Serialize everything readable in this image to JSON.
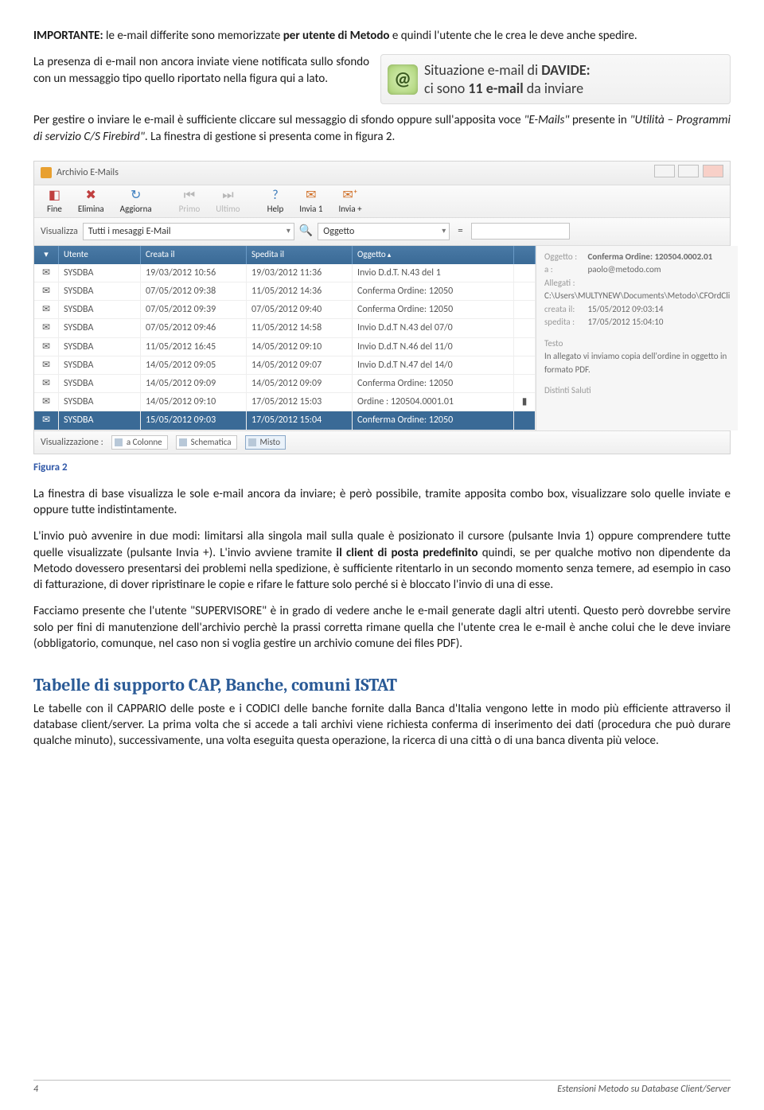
{
  "text": {
    "p1": "IMPORTANTE: le e-mail differite sono memorizzate per utente di Metodo e quindi l'utente che le crea le deve anche spedire.",
    "p2": "La presenza di e-mail non ancora inviate viene notificata sullo sfondo con un messaggio tipo quello riportato nella figura qui a lato.",
    "p3": "Per gestire o inviare le e-mail è sufficiente cliccare sul messaggio di sfondo oppure sull'apposita voce \"E-Mails\" presente in \"Utilità – Programmi di servizio C/S Firebird\". La finestra di gestione si presenta come in figura 2.",
    "caption": "Figura 2",
    "p4": "La finestra di base visualizza le sole e-mail ancora da inviare; è però possibile, tramite apposita combo box, visualizzare solo quelle inviate e oppure tutte indistintamente.",
    "p5": "L'invio può avvenire in due modi: limitarsi alla singola mail sulla quale è posizionato il cursore (pulsante Invia 1) oppure comprendere tutte quelle visualizzate (pulsante Invia +). L'invio avviene tramite il client di posta predefinito quindi, se per qualche motivo non dipendente da Metodo dovessero presentarsi dei problemi nella spedizione, è sufficiente ritentarlo in un secondo momento senza temere, ad esempio in caso di fatturazione, di dover ripristinare le copie e rifare le fatture solo perché si è bloccato l'invio di una di esse.",
    "p6": "Facciamo presente che l'utente \"SUPERVISORE\" è in grado di vedere anche le e-mail generate dagli altri utenti. Questo però dovrebbe servire solo per fini di manutenzione dell'archivio perchè la prassi corretta rimane quella che l'utente crea le e-mail è anche colui che le deve inviare (obbligatorio, comunque, nel caso non si voglia gestire un archivio comune dei files PDF).",
    "h2": "Tabelle di supporto CAP, Banche, comuni ISTAT",
    "p7": "Le tabelle con il CAPPARIO delle poste e i CODICI delle banche fornite dalla Banca d'Italia vengono lette in modo più efficiente attraverso il database client/server. La prima volta che si accede a tali archivi viene richiesta conferma di inserimento dei dati (procedura che può durare qualche minuto), successivamente, una volta eseguita questa operazione, la ricerca di una città o di una banca diventa più veloce."
  },
  "notify": {
    "line1_pre": "Situazione e-mail di ",
    "line1_bold": "DAVIDE:",
    "line2_pre": "ci sono ",
    "line2_bold": "11 e-mail",
    "line2_post": " da inviare"
  },
  "archive": {
    "title": "Archivio E-Mails",
    "toolbar": {
      "fine": "Fine",
      "elimina": "Elimina",
      "aggiorna": "Aggiorna",
      "primo": "Primo",
      "ultimo": "Ultimo",
      "help": "Help",
      "invia1": "Invia 1",
      "inviap": "Invia +"
    },
    "filter": {
      "visualizza_label": "Visualizza",
      "visualizza_value": "Tutti i mesaggi E-Mail",
      "oggetto_label": "Oggetto",
      "eq": "="
    },
    "columns": {
      "utente": "Utente",
      "creata": "Creata il",
      "spedita": "Spedita il",
      "oggetto": "Oggetto"
    },
    "rows": [
      {
        "utente": "SYSDBA",
        "creata": "19/03/2012 10:56",
        "spedita": "19/03/2012 11:36",
        "oggetto": "Invio D.d.T. N.43    del 1"
      },
      {
        "utente": "SYSDBA",
        "creata": "07/05/2012 09:38",
        "spedita": "11/05/2012 14:36",
        "oggetto": "Conferma Ordine: 12050"
      },
      {
        "utente": "SYSDBA",
        "creata": "07/05/2012 09:39",
        "spedita": "07/05/2012 09:40",
        "oggetto": "Conferma Ordine: 12050"
      },
      {
        "utente": "SYSDBA",
        "creata": "07/05/2012 09:46",
        "spedita": "11/05/2012 14:58",
        "oggetto": "Invio D.d.T N.43 del 07/0"
      },
      {
        "utente": "SYSDBA",
        "creata": "11/05/2012 16:45",
        "spedita": "14/05/2012 09:10",
        "oggetto": "Invio D.d.T N.46 del 11/0"
      },
      {
        "utente": "SYSDBA",
        "creata": "14/05/2012 09:05",
        "spedita": "14/05/2012 09:07",
        "oggetto": "Invio D.d.T N.47 del 14/0"
      },
      {
        "utente": "SYSDBA",
        "creata": "14/05/2012 09:09",
        "spedita": "14/05/2012 09:09",
        "oggetto": "Conferma Ordine: 12050"
      },
      {
        "utente": "SYSDBA",
        "creata": "14/05/2012 09:10",
        "spedita": "17/05/2012 15:03",
        "oggetto": "Ordine : 120504.0001.01"
      },
      {
        "utente": "SYSDBA",
        "creata": "15/05/2012 09:03",
        "spedita": "17/05/2012 15:04",
        "oggetto": "Conferma Ordine: 12050",
        "selected": true
      }
    ],
    "detail": {
      "oggetto_lab": "Oggetto :",
      "oggetto_val": "Conferma Ordine: 120504.0002.01",
      "a_lab": "a :",
      "a_val": "paolo@metodo.com",
      "allegati_lab": "Allegati :",
      "allegati_val": "C:\\Users\\MULTYNEW\\Documents\\Metodo\\CFOrdCli",
      "creata_lab": "creata il:",
      "creata_val": "15/05/2012 09:03:14",
      "spedita_lab": "spedita :",
      "spedita_val": "17/05/2012 15:04:10",
      "testo_head": "Testo",
      "testo_body": "In allegato vi inviamo copia dell'ordine in oggetto in formato PDF.",
      "saluti": "Distinti Saluti"
    },
    "status": {
      "label": "Visualizzazione :",
      "colonne": "a Colonne",
      "schematica": "Schematica",
      "misto": "Misto"
    }
  },
  "footer": {
    "page": "4",
    "title": "Estensioni Metodo su Database Client/Server"
  }
}
